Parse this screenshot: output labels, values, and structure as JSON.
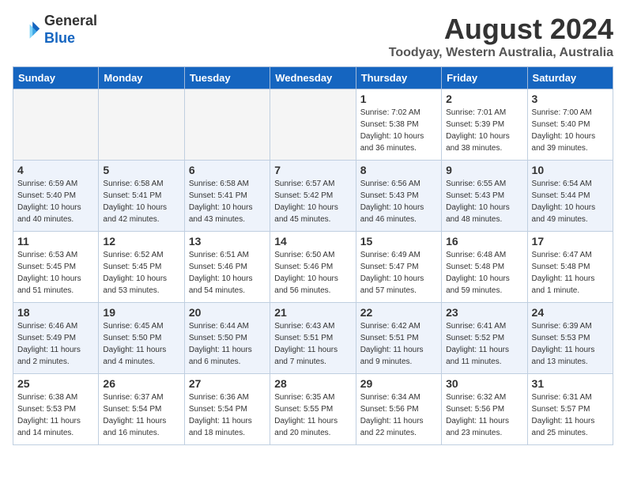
{
  "header": {
    "logo_general": "General",
    "logo_blue": "Blue",
    "month_year": "August 2024",
    "location": "Toodyay, Western Australia, Australia"
  },
  "weekdays": [
    "Sunday",
    "Monday",
    "Tuesday",
    "Wednesday",
    "Thursday",
    "Friday",
    "Saturday"
  ],
  "weeks": [
    [
      {
        "day": "",
        "info": ""
      },
      {
        "day": "",
        "info": ""
      },
      {
        "day": "",
        "info": ""
      },
      {
        "day": "",
        "info": ""
      },
      {
        "day": "1",
        "info": "Sunrise: 7:02 AM\nSunset: 5:38 PM\nDaylight: 10 hours\nand 36 minutes."
      },
      {
        "day": "2",
        "info": "Sunrise: 7:01 AM\nSunset: 5:39 PM\nDaylight: 10 hours\nand 38 minutes."
      },
      {
        "day": "3",
        "info": "Sunrise: 7:00 AM\nSunset: 5:40 PM\nDaylight: 10 hours\nand 39 minutes."
      }
    ],
    [
      {
        "day": "4",
        "info": "Sunrise: 6:59 AM\nSunset: 5:40 PM\nDaylight: 10 hours\nand 40 minutes."
      },
      {
        "day": "5",
        "info": "Sunrise: 6:58 AM\nSunset: 5:41 PM\nDaylight: 10 hours\nand 42 minutes."
      },
      {
        "day": "6",
        "info": "Sunrise: 6:58 AM\nSunset: 5:41 PM\nDaylight: 10 hours\nand 43 minutes."
      },
      {
        "day": "7",
        "info": "Sunrise: 6:57 AM\nSunset: 5:42 PM\nDaylight: 10 hours\nand 45 minutes."
      },
      {
        "day": "8",
        "info": "Sunrise: 6:56 AM\nSunset: 5:43 PM\nDaylight: 10 hours\nand 46 minutes."
      },
      {
        "day": "9",
        "info": "Sunrise: 6:55 AM\nSunset: 5:43 PM\nDaylight: 10 hours\nand 48 minutes."
      },
      {
        "day": "10",
        "info": "Sunrise: 6:54 AM\nSunset: 5:44 PM\nDaylight: 10 hours\nand 49 minutes."
      }
    ],
    [
      {
        "day": "11",
        "info": "Sunrise: 6:53 AM\nSunset: 5:45 PM\nDaylight: 10 hours\nand 51 minutes."
      },
      {
        "day": "12",
        "info": "Sunrise: 6:52 AM\nSunset: 5:45 PM\nDaylight: 10 hours\nand 53 minutes."
      },
      {
        "day": "13",
        "info": "Sunrise: 6:51 AM\nSunset: 5:46 PM\nDaylight: 10 hours\nand 54 minutes."
      },
      {
        "day": "14",
        "info": "Sunrise: 6:50 AM\nSunset: 5:46 PM\nDaylight: 10 hours\nand 56 minutes."
      },
      {
        "day": "15",
        "info": "Sunrise: 6:49 AM\nSunset: 5:47 PM\nDaylight: 10 hours\nand 57 minutes."
      },
      {
        "day": "16",
        "info": "Sunrise: 6:48 AM\nSunset: 5:48 PM\nDaylight: 10 hours\nand 59 minutes."
      },
      {
        "day": "17",
        "info": "Sunrise: 6:47 AM\nSunset: 5:48 PM\nDaylight: 11 hours\nand 1 minute."
      }
    ],
    [
      {
        "day": "18",
        "info": "Sunrise: 6:46 AM\nSunset: 5:49 PM\nDaylight: 11 hours\nand 2 minutes."
      },
      {
        "day": "19",
        "info": "Sunrise: 6:45 AM\nSunset: 5:50 PM\nDaylight: 11 hours\nand 4 minutes."
      },
      {
        "day": "20",
        "info": "Sunrise: 6:44 AM\nSunset: 5:50 PM\nDaylight: 11 hours\nand 6 minutes."
      },
      {
        "day": "21",
        "info": "Sunrise: 6:43 AM\nSunset: 5:51 PM\nDaylight: 11 hours\nand 7 minutes."
      },
      {
        "day": "22",
        "info": "Sunrise: 6:42 AM\nSunset: 5:51 PM\nDaylight: 11 hours\nand 9 minutes."
      },
      {
        "day": "23",
        "info": "Sunrise: 6:41 AM\nSunset: 5:52 PM\nDaylight: 11 hours\nand 11 minutes."
      },
      {
        "day": "24",
        "info": "Sunrise: 6:39 AM\nSunset: 5:53 PM\nDaylight: 11 hours\nand 13 minutes."
      }
    ],
    [
      {
        "day": "25",
        "info": "Sunrise: 6:38 AM\nSunset: 5:53 PM\nDaylight: 11 hours\nand 14 minutes."
      },
      {
        "day": "26",
        "info": "Sunrise: 6:37 AM\nSunset: 5:54 PM\nDaylight: 11 hours\nand 16 minutes."
      },
      {
        "day": "27",
        "info": "Sunrise: 6:36 AM\nSunset: 5:54 PM\nDaylight: 11 hours\nand 18 minutes."
      },
      {
        "day": "28",
        "info": "Sunrise: 6:35 AM\nSunset: 5:55 PM\nDaylight: 11 hours\nand 20 minutes."
      },
      {
        "day": "29",
        "info": "Sunrise: 6:34 AM\nSunset: 5:56 PM\nDaylight: 11 hours\nand 22 minutes."
      },
      {
        "day": "30",
        "info": "Sunrise: 6:32 AM\nSunset: 5:56 PM\nDaylight: 11 hours\nand 23 minutes."
      },
      {
        "day": "31",
        "info": "Sunrise: 6:31 AM\nSunset: 5:57 PM\nDaylight: 11 hours\nand 25 minutes."
      }
    ]
  ]
}
